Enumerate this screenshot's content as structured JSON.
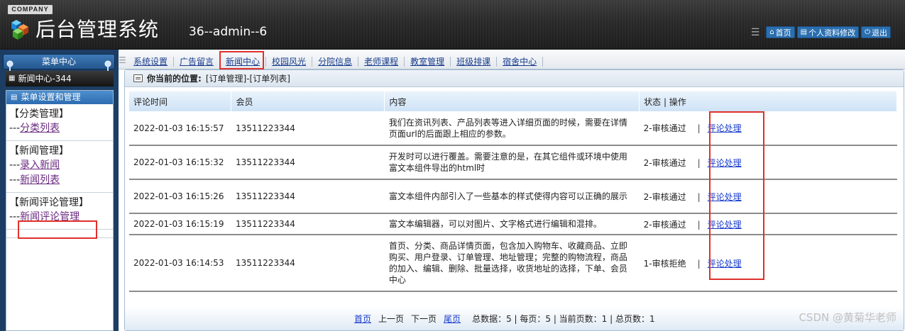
{
  "header": {
    "company": "COMPANY",
    "title": "后台管理系统",
    "user": "36--admin--6",
    "nav": [
      {
        "icon": "home-icon",
        "label": "首页"
      },
      {
        "icon": "profile-icon",
        "label": "个人资料修改"
      },
      {
        "icon": "power-icon",
        "label": "退出"
      }
    ]
  },
  "sidebar": {
    "top_label": "菜单中心",
    "news_item": "新闻中心-344",
    "panel_title": "菜单设置和管理",
    "groups": [
      {
        "title": "【分类管理】",
        "items": [
          {
            "prefix": "---",
            "label": "分类列表"
          }
        ]
      },
      {
        "title": "【新闻管理】",
        "items": [
          {
            "prefix": "---",
            "label": "录入新闻"
          },
          {
            "prefix": "---",
            "label": "新闻列表"
          }
        ]
      },
      {
        "title": "【新闻评论管理】",
        "items": [
          {
            "prefix": "---",
            "label": "新闻评论管理"
          }
        ]
      }
    ]
  },
  "tabs": [
    "系统设置",
    "广告留言",
    "新闻中心",
    "校园风光",
    "分院信息",
    "老师课程",
    "教室管理",
    "班级排课",
    "宿舍中心"
  ],
  "breadcrumb": {
    "label": "你当前的位置:",
    "path": "[订单管理]-[订单列表]"
  },
  "table": {
    "columns": [
      "评论时间",
      "会员",
      "内容",
      "状态 | 操作"
    ],
    "rows": [
      {
        "time": "2022-01-03 16:15:57",
        "member": "13511223344",
        "content": "我们在资讯列表、产品列表等进入详细页面的时候，需要在详情页面url的后面跟上相应的参数。",
        "status": "2-审核通过",
        "action": "评论处理"
      },
      {
        "time": "2022-01-03 16:15:32",
        "member": "13511223344",
        "content": "开发时可以进行覆盖。需要注意的是，在其它组件或环境中使用富文本组件导出的html时",
        "status": "2-审核通过",
        "action": "评论处理"
      },
      {
        "time": "2022-01-03 16:15:26",
        "member": "13511223344",
        "content": "富文本组件内部引入了一些基本的样式使得内容可以正确的展示",
        "status": "2-审核通过",
        "action": "评论处理"
      },
      {
        "time": "2022-01-03 16:15:19",
        "member": "13511223344",
        "content": "富文本编辑器，可以对图片、文字格式进行编辑和混排。",
        "status": "2-审核通过",
        "action": "评论处理"
      },
      {
        "time": "2022-01-03 16:14:53",
        "member": "13511223344",
        "content": "首页、分类、商品详情页面，包含加入购物车、收藏商品、立即购买、用户登录、订单管理、地址管理；完整的购物流程，商品的加入、编辑、删除、批量选择，收货地址的选择，下单、会员中心",
        "status": "1-审核拒绝",
        "action": "评论处理"
      }
    ]
  },
  "pager": {
    "first": "首页",
    "prev": "上一页",
    "next": "下一页",
    "last": "尾页",
    "stats": "总数据：5 | 每页：5 | 当前页数：1 | 总页数：1"
  },
  "watermark": "CSDN @黄菊华老师",
  "colors": {
    "header_bg": "#2a2a2a",
    "sidebar_bg": "#1d3e64",
    "link": "#1a3dcc",
    "highlight": "#e0302c"
  }
}
